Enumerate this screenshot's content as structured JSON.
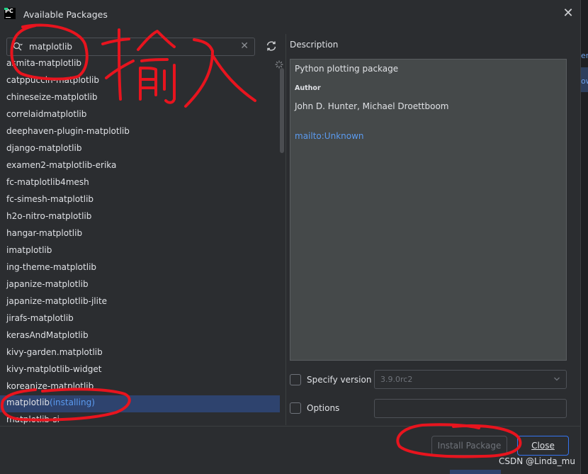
{
  "window": {
    "title": "Available Packages",
    "app_icon_text": "PC"
  },
  "search": {
    "value": "matplotlib",
    "placeholder": ""
  },
  "packages": [
    "asmita-matplotlib",
    "catppuccin-matplotlib",
    "chineseize-matplotlib",
    "correlaidmatplotlib",
    "deephaven-plugin-matplotlib",
    "django-matplotlib",
    "examen2-matplotlib-erika",
    "fc-matplotlib4mesh",
    "fc-simesh-matplotlib",
    "h2o-nitro-matplotlib",
    "hangar-matplotlib",
    "imatplotlib",
    "ing-theme-matplotlib",
    "japanize-matplotlib",
    "japanize-matplotlib-jlite",
    "jirafs-matplotlib",
    "kerasAndMatplotlib",
    "kivy-garden.matplotlib",
    "kivy-matplotlib-widget",
    "koreanize-matplotlib"
  ],
  "selected": {
    "name": "matplotlib",
    "status": "(installing)"
  },
  "next_partial": "matplotlib-si",
  "description": {
    "label": "Description",
    "summary": "Python plotting package",
    "author_heading": "Author",
    "author": "John D. Hunter, Michael Droettboom",
    "mail_link": "mailto:Unknown"
  },
  "options": {
    "specify_version_label": "Specify version",
    "version_value": "3.9.0rc2",
    "options_label": "Options"
  },
  "buttons": {
    "install": "Install Package",
    "close": "Close"
  },
  "background_fragments": [
    "erp",
    "ow"
  ],
  "watermark": "CSDN @Linda_mu",
  "annotation_text": "输入",
  "colors": {
    "background": "#2b2d30",
    "selection": "#2e436e",
    "link": "#5b9bf0",
    "annotation": "#e8141e",
    "accent_border": "#3574f0"
  }
}
